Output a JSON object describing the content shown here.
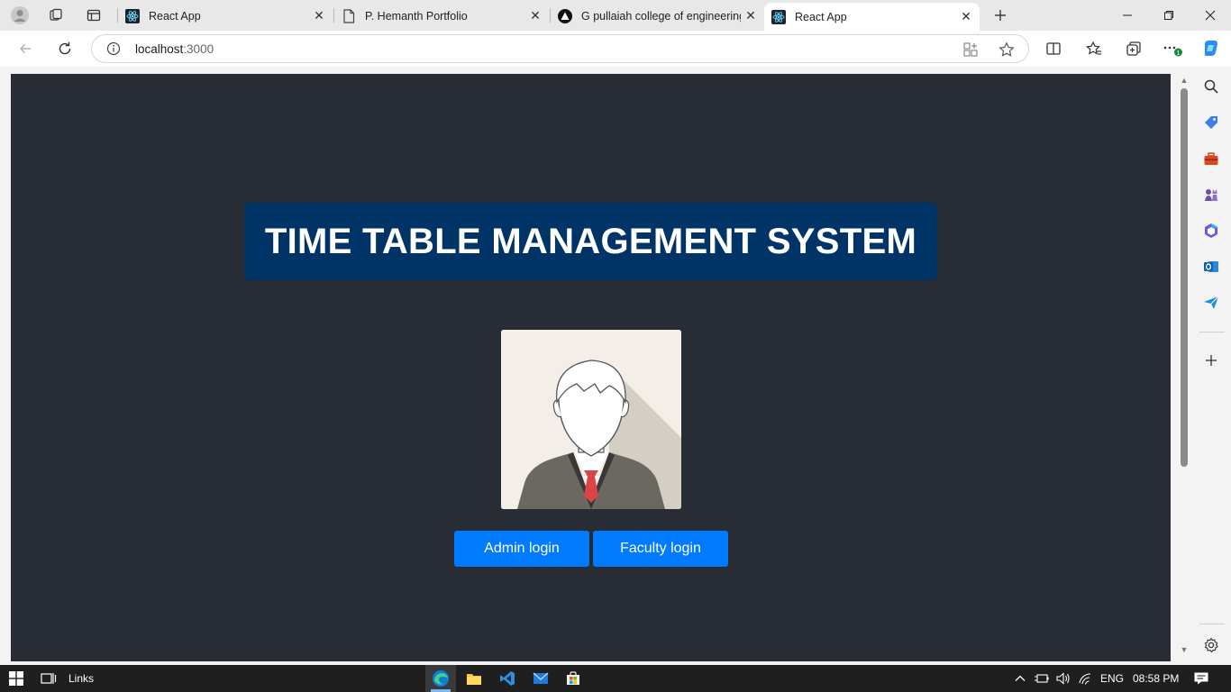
{
  "browser": {
    "tabs": [
      {
        "label": "React App",
        "icon": "react-icon",
        "active": false
      },
      {
        "label": "P. Hemanth Portfolio",
        "icon": "document-icon",
        "active": false
      },
      {
        "label": "G pullaiah college of engineering",
        "icon": "triangle-logo-icon",
        "active": false
      },
      {
        "label": "React App",
        "icon": "react-icon",
        "active": true
      }
    ],
    "address": {
      "host": "localhost",
      "port": ":3000"
    }
  },
  "page": {
    "title": "TIME TABLE MANAGEMENT SYSTEM",
    "buttons": {
      "admin": "Admin login",
      "faculty": "Faculty login"
    }
  },
  "taskbar": {
    "links_label": "Links",
    "language": "ENG",
    "time": "08:58 PM"
  },
  "colors": {
    "page_bg": "#282c34",
    "title_bg": "#003366",
    "button_bg": "#007bff"
  }
}
